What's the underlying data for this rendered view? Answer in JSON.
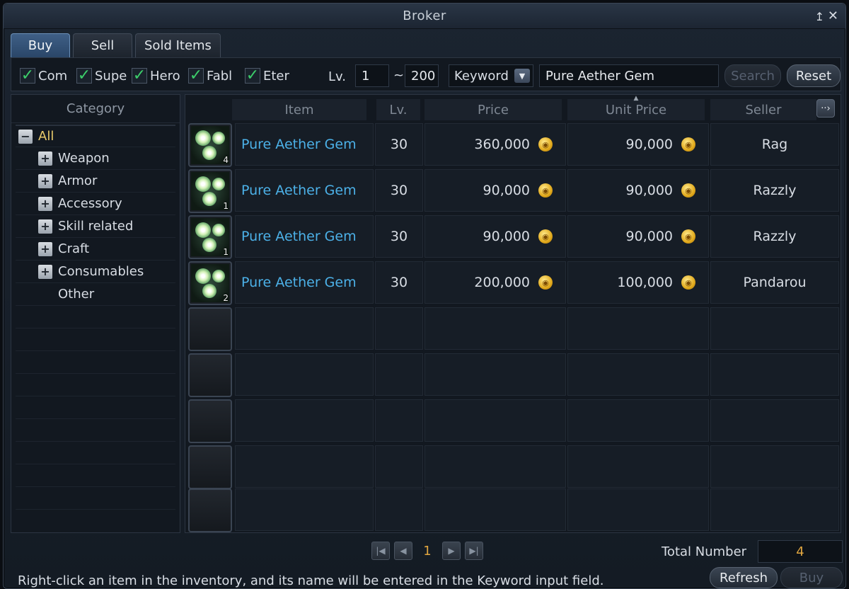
{
  "window": {
    "title": "Broker",
    "pin_glyph": "↥",
    "close_glyph": "✕"
  },
  "tabs": [
    {
      "label": "Buy",
      "active": true
    },
    {
      "label": "Sell",
      "active": false
    },
    {
      "label": "Sold Items",
      "active": false
    }
  ],
  "filters": {
    "checkboxes": [
      {
        "label": "Com",
        "checked": true
      },
      {
        "label": "Supe",
        "checked": true
      },
      {
        "label": "Hero",
        "checked": true
      },
      {
        "label": "Fabl",
        "checked": true
      },
      {
        "label": "Eter",
        "checked": true
      }
    ],
    "lv_label": "Lv.",
    "lv_min": "1",
    "lv_sep": "~",
    "lv_max": "200",
    "keyword_type": "Keyword",
    "keyword_value": "Pure Aether Gem",
    "search_label": "Search",
    "reset_label": "Reset"
  },
  "category": {
    "header": "Category",
    "items": [
      {
        "label": "All",
        "toggle": "−"
      },
      {
        "label": "Weapon",
        "toggle": "+"
      },
      {
        "label": "Armor",
        "toggle": "+"
      },
      {
        "label": "Accessory",
        "toggle": "+"
      },
      {
        "label": "Skill related",
        "toggle": "+"
      },
      {
        "label": "Craft",
        "toggle": "+"
      },
      {
        "label": "Consumables",
        "toggle": "+"
      },
      {
        "label": "Other",
        "toggle": ""
      }
    ]
  },
  "table": {
    "headers": {
      "item": "Item",
      "lv": "Lv.",
      "price": "Price",
      "unit_price": "Unit Price",
      "seller": "Seller"
    },
    "more_glyph": "··›",
    "rows": [
      {
        "stack": "4",
        "name": "Pure Aether Gem",
        "lv": "30",
        "price": "360,000",
        "unit_price": "90,000",
        "seller": "Rag"
      },
      {
        "stack": "1",
        "name": "Pure Aether Gem",
        "lv": "30",
        "price": "90,000",
        "unit_price": "90,000",
        "seller": "Razzly"
      },
      {
        "stack": "1",
        "name": "Pure Aether Gem",
        "lv": "30",
        "price": "90,000",
        "unit_price": "90,000",
        "seller": "Razzly"
      },
      {
        "stack": "2",
        "name": "Pure Aether Gem",
        "lv": "30",
        "price": "200,000",
        "unit_price": "100,000",
        "seller": "Pandarou"
      }
    ],
    "empty_rows": 5
  },
  "pager": {
    "first": "|◀",
    "prev": "◀",
    "page": "1",
    "next": "▶",
    "last": "▶|"
  },
  "total": {
    "label": "Total Number",
    "value": "4"
  },
  "footer": {
    "hint": "Right-click an item in the inventory, and its name will be entered in the Keyword input field.",
    "refresh_label": "Refresh",
    "buy_label": "Buy"
  }
}
